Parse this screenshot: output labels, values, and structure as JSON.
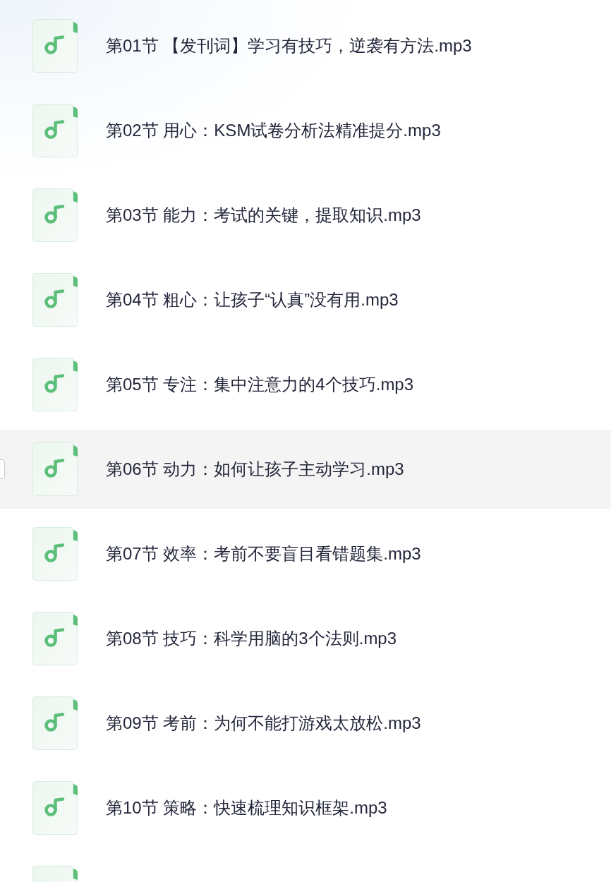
{
  "files": [
    {
      "name": "第01节 【发刊词】学习有技巧，逆袭有方法.mp3",
      "hovered": false,
      "checked": false
    },
    {
      "name": "第02节 用心：KSM试卷分析法精准提分.mp3",
      "hovered": false,
      "checked": false
    },
    {
      "name": "第03节 能力：考试的关键，提取知识.mp3",
      "hovered": false,
      "checked": false
    },
    {
      "name": "第04节 粗心：让孩子“认真”没有用.mp3",
      "hovered": false,
      "checked": false
    },
    {
      "name": "第05节 专注：集中注意力的4个技巧.mp3",
      "hovered": false,
      "checked": false
    },
    {
      "name": "第06节 动力：如何让孩子主动学习.mp3",
      "hovered": true,
      "checked": false
    },
    {
      "name": "第07节 效率：考前不要盲目看错题集.mp3",
      "hovered": false,
      "checked": false
    },
    {
      "name": "第08节 技巧：科学用脑的3个法则.mp3",
      "hovered": false,
      "checked": false
    },
    {
      "name": "第09节 考前：为何不能打游戏太放松.mp3",
      "hovered": false,
      "checked": false
    },
    {
      "name": "第10节 策略：快速梳理知识框架.mp3",
      "hovered": false,
      "checked": false
    },
    {
      "hovered": false,
      "checked": false
    }
  ]
}
